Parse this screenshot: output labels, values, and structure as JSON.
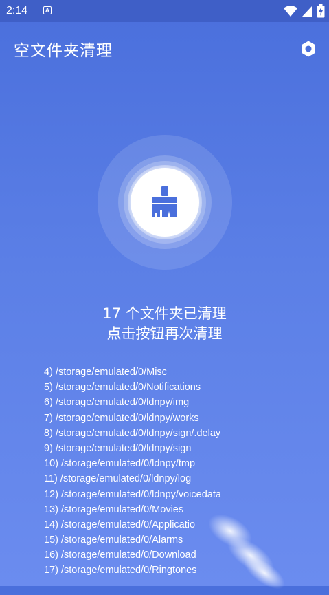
{
  "status_bar": {
    "time": "2:14",
    "a_badge": "A",
    "icons": [
      "wifi-icon",
      "cell-signal-icon",
      "battery-charging-icon"
    ]
  },
  "app_bar": {
    "title": "空文件夹清理",
    "settings_icon": "hexagon-settings-icon"
  },
  "clean_button": {
    "icon": "broom-icon"
  },
  "summary": {
    "line1": "17 个文件夹已清理",
    "line2": "点击按钮再次清理"
  },
  "folders": [
    "4) /storage/emulated/0/Misc",
    "5) /storage/emulated/0/Notifications",
    "6) /storage/emulated/0/ldnpy/img",
    "7) /storage/emulated/0/ldnpy/works",
    "8) /storage/emulated/0/ldnpy/sign/.delay",
    "9) /storage/emulated/0/ldnpy/sign",
    "10) /storage/emulated/0/ldnpy/tmp",
    "11) /storage/emulated/0/ldnpy/log",
    "12) /storage/emulated/0/ldnpy/voicedata",
    "13) /storage/emulated/0/Movies",
    "14) /storage/emulated/0/Applicatio",
    "15) /storage/emulated/0/Alarms",
    "16) /storage/emulated/0/Download",
    "17) /storage/emulated/0/Ringtones"
  ],
  "colors": {
    "background_top": "#4a6fdc",
    "background_bottom": "#6b8cef",
    "status_bar": "#3f5fc7",
    "broom": "#4a6fdc"
  }
}
